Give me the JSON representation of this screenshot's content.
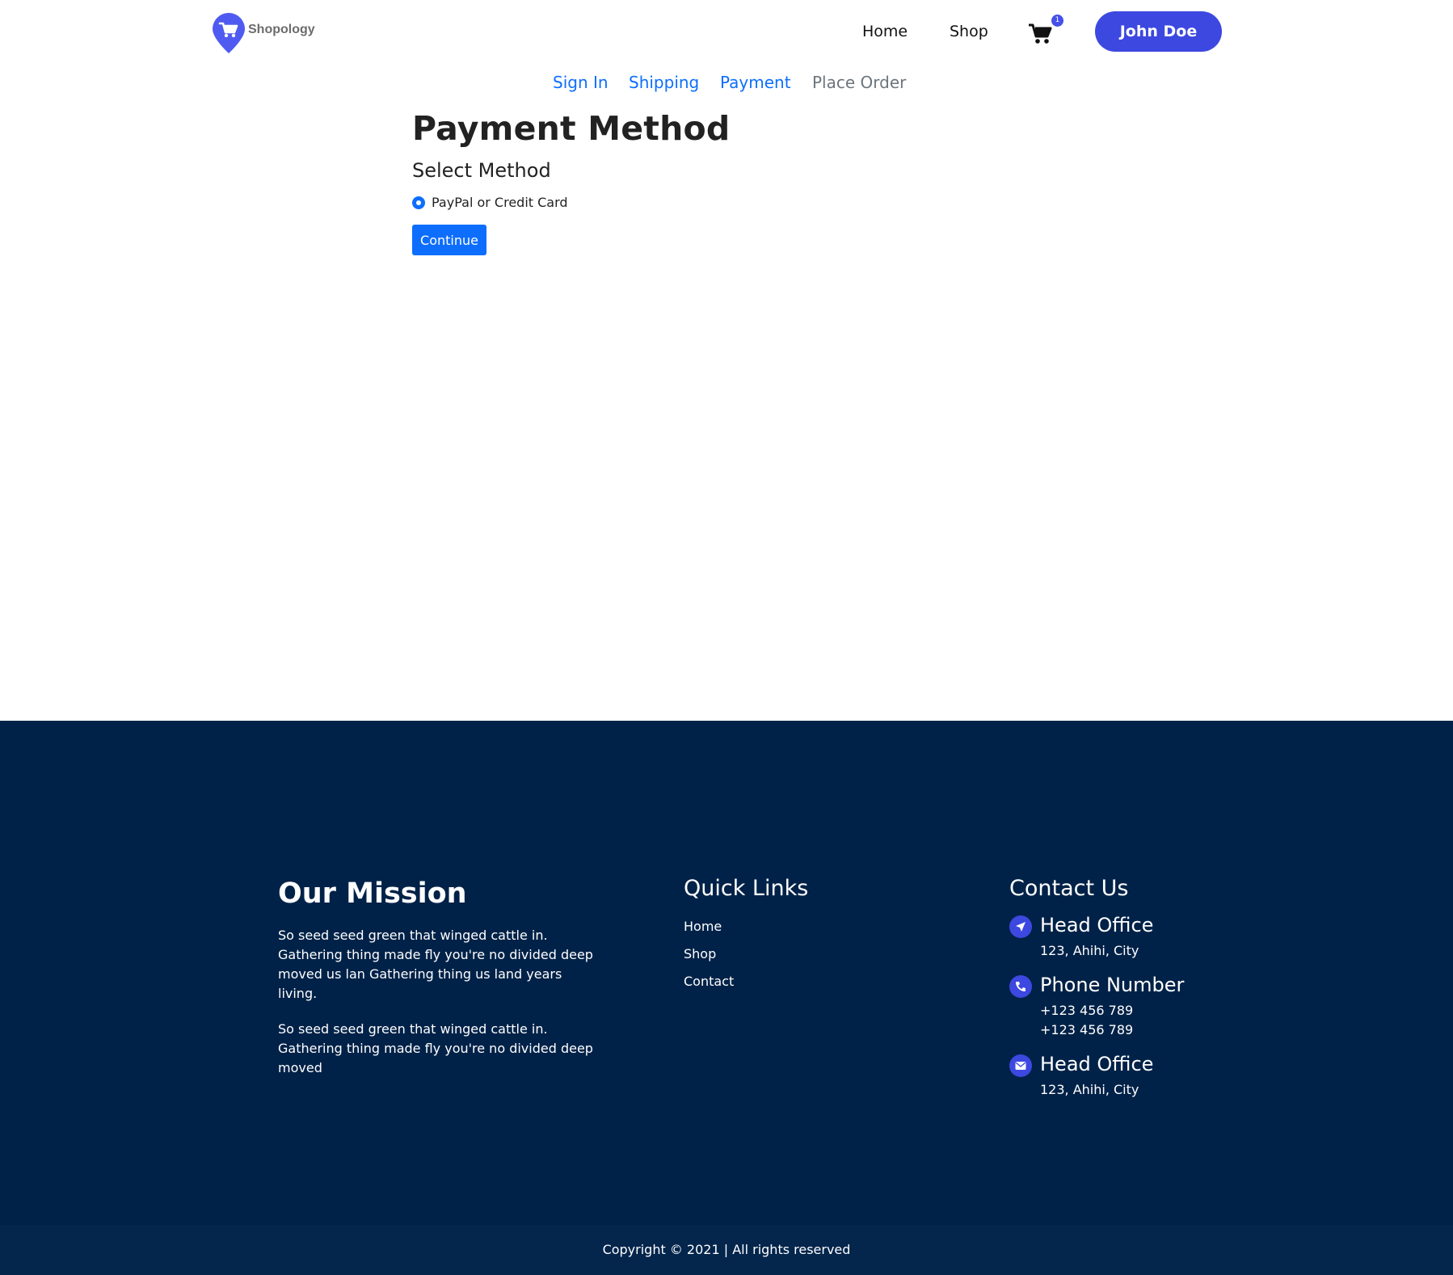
{
  "brand": {
    "name": "Shopology",
    "accent": "#3d48e0"
  },
  "nav": {
    "home": "Home",
    "shop": "Shop",
    "cart_count": "1",
    "user": "John Doe"
  },
  "steps": [
    {
      "label": "Sign In",
      "state": "active"
    },
    {
      "label": "Shipping",
      "state": "active"
    },
    {
      "label": "Payment",
      "state": "active"
    },
    {
      "label": "Place Order",
      "state": "disabled"
    }
  ],
  "main": {
    "title": "Payment Method",
    "legend": "Select Method",
    "option_label": "PayPal or Credit Card",
    "continue": "Continue"
  },
  "footer": {
    "mission": {
      "title": "Our Mission",
      "p1": "So seed seed green that winged cattle in. Gathering thing made fly you're no divided deep moved us lan Gathering thing us land years living.",
      "p2": "So seed seed green that winged cattle in. Gathering thing made fly you're no divided deep moved"
    },
    "links": {
      "title": "Quick Links",
      "items": [
        "Home",
        "Shop",
        "Contact"
      ]
    },
    "contact": {
      "title": "Contact Us",
      "items": [
        {
          "icon": "location-arrow-icon",
          "heading": "Head Office",
          "lines": [
            "123, Ahihi, City"
          ]
        },
        {
          "icon": "phone-icon",
          "heading": "Phone Number",
          "lines": [
            "+123 456 789",
            "+123 456 789"
          ]
        },
        {
          "icon": "envelope-icon",
          "heading": "Head Office",
          "lines": [
            "123, Ahihi, City"
          ]
        }
      ]
    },
    "copyright": "Copyright © 2021 | All rights reserved",
    "bg_color": "#012248"
  }
}
